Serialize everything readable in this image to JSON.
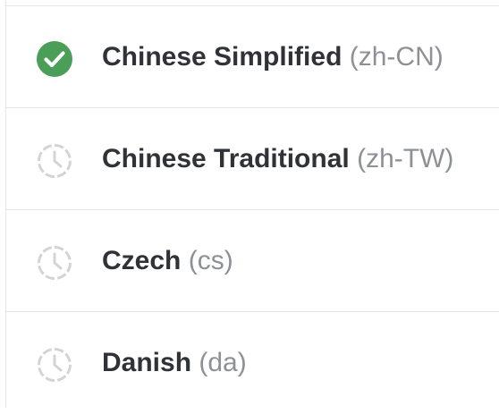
{
  "colors": {
    "complete": "#4a9e57",
    "pending": "#d3d4d6",
    "name": "#2f3338",
    "code": "#8d9196",
    "divider": "#e3e4e6"
  },
  "languages": [
    {
      "name": "Chinese Simplified",
      "code": "(zh-CN)",
      "status": "complete",
      "icon": "check-circle-icon"
    },
    {
      "name": "Chinese Traditional",
      "code": "(zh-TW)",
      "status": "pending",
      "icon": "clock-icon"
    },
    {
      "name": "Czech",
      "code": "(cs)",
      "status": "pending",
      "icon": "clock-icon"
    },
    {
      "name": "Danish",
      "code": "(da)",
      "status": "pending",
      "icon": "clock-icon"
    }
  ]
}
